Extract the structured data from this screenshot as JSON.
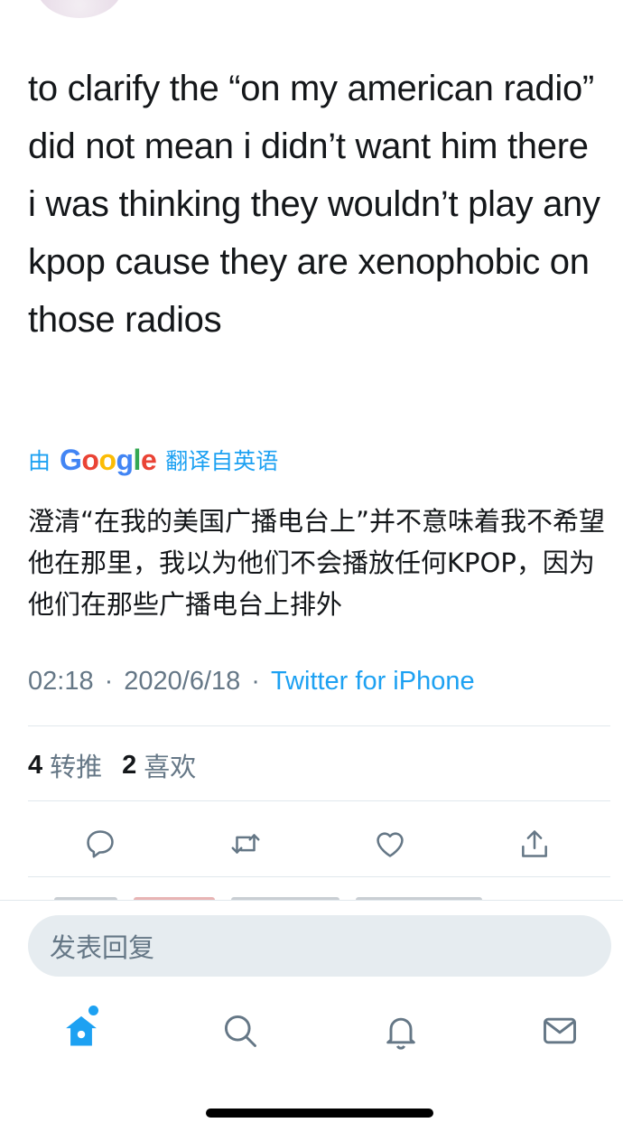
{
  "tweet": {
    "text": "to clarify the “on my american radio” did not mean i didn’t want him there i was thinking they wouldn’t play any kpop cause they are xenophobic on those radios",
    "translated_by_prefix": "由",
    "translated_by_brand": [
      "G",
      "o",
      "o",
      "g",
      "l",
      "e"
    ],
    "translated_by_suffix": "翻译自英语",
    "translation": "澄清“在我的美国广播电台上”并不意味着我不希望他在那里，我以为他们不会播放任何KPOP，因为他们在那些广播电台上排外",
    "time": "02:18",
    "separator": "·",
    "date": "2020/6/18",
    "source": "Twitter for iPhone"
  },
  "stats": {
    "retweets_count": "4",
    "retweets_label": "转推",
    "likes_count": "2",
    "likes_label": "喜欢"
  },
  "actions": [
    "reply-icon",
    "retweet-icon",
    "like-icon",
    "share-icon"
  ],
  "reply_box": {
    "placeholder": "发表回复"
  },
  "tab_bar": [
    "home-icon",
    "search-icon",
    "notifications-icon",
    "messages-icon"
  ],
  "colors": {
    "accent": "#1da1f2",
    "text": "#14171a",
    "secondary": "#657786",
    "divider": "#e1e8ed"
  }
}
